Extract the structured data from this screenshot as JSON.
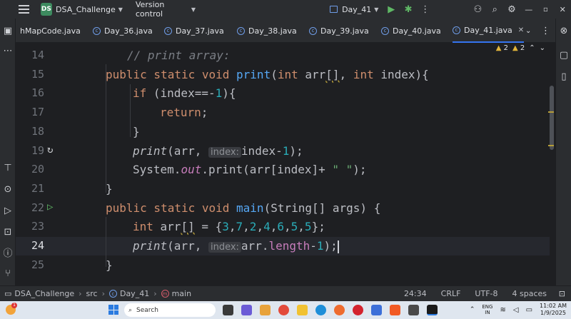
{
  "titlebar": {
    "project_badge": "DS",
    "project_name": "DSA_Challenge",
    "vcs_label": "Version control",
    "run_config": "Day_41",
    "run_icon": "play-icon",
    "debug_icon": "bug-icon"
  },
  "tabs": [
    {
      "label": "hMapCode.java",
      "active": false
    },
    {
      "label": "Day_36.java",
      "active": false
    },
    {
      "label": "Day_37.java",
      "active": false
    },
    {
      "label": "Day_38.java",
      "active": false
    },
    {
      "label": "Day_39.java",
      "active": false
    },
    {
      "label": "Day_40.java",
      "active": false
    },
    {
      "label": "Day_41.java",
      "active": true
    }
  ],
  "editor": {
    "line_numbers": [
      "14",
      "15",
      "16",
      "17",
      "18",
      "19",
      "20",
      "21",
      "22",
      "23",
      "24",
      "25"
    ],
    "current_line": "24",
    "warnings_a": "2",
    "warnings_b": "2",
    "hint_index": "index:"
  },
  "code": {
    "l14_comment": "// print array:",
    "l15_a": "public static void ",
    "l15_fn": "print",
    "l15_b": "(",
    "l15_int1": "int",
    "l15_c": " arr",
    "l15_brk": "[]",
    "l15_d": ", ",
    "l15_int2": "int",
    "l15_e": " index){",
    "l16_if": "if",
    "l16_a": " (index==-",
    "l16_num": "1",
    "l16_b": "){",
    "l17_return": "return",
    "l17_semi": ";",
    "l18": "}",
    "l19_fn": "print",
    "l19_a": "(arr, ",
    "l19_b": "index-",
    "l19_num": "1",
    "l19_c": ");",
    "l20_a": "System.",
    "l20_out": "out",
    "l20_b": ".print(arr[index]+ ",
    "l20_str": "\" \"",
    "l20_c": ");",
    "l21": "}",
    "l22_a": "public static void ",
    "l22_fn": "main",
    "l22_b": "(String[] args) {",
    "l23_int": "int",
    "l23_a": " arr",
    "l23_brk": "[]",
    "l23_b": " = {",
    "l23_vals": [
      "3",
      "7",
      "2",
      "4",
      "6",
      "5",
      "5"
    ],
    "l23_c": "};",
    "l24_fn": "print",
    "l24_a": "(arr, ",
    "l24_b": "arr.",
    "l24_length": "length",
    "l24_c": "-",
    "l24_num": "1",
    "l24_d": ");",
    "l25": "}"
  },
  "statusbar": {
    "project": "DSA_Challenge",
    "folder": "src",
    "file": "Day_41",
    "method": "main",
    "position": "24:34",
    "line_sep": "CRLF",
    "encoding": "UTF-8",
    "indent": "4 spaces"
  },
  "taskbar": {
    "search_placeholder": "Search",
    "notification_count": "1",
    "lang_top": "ENG",
    "lang_bottom": "IN",
    "time": "11:02 AM",
    "date": "1/9/2025"
  },
  "colors": {
    "accent": "#3574f0",
    "keyword": "#cf8e6d",
    "function": "#56a8f5",
    "number": "#2aacb8",
    "string": "#6aab73"
  }
}
